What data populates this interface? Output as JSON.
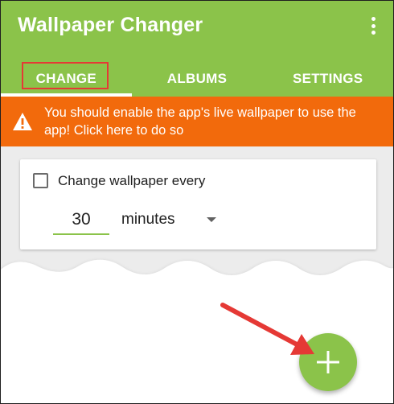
{
  "app": {
    "title": "Wallpaper Changer"
  },
  "tabs": [
    {
      "label": "CHANGE",
      "active": true
    },
    {
      "label": "ALBUMS",
      "active": false
    },
    {
      "label": "SETTINGS",
      "active": false
    }
  ],
  "banner": {
    "line1": "You should enable the app's live wallpaper to use the",
    "line2": "app! Click here to do so",
    "icon": "warning-icon"
  },
  "card": {
    "checkbox_label": "Change wallpaper every",
    "checked": false,
    "interval_value": "30",
    "unit_value": "minutes"
  },
  "fab": {
    "icon": "plus-icon"
  },
  "colors": {
    "primary": "#8bc34a",
    "warning": "#f26a0c",
    "annotation": "#e53935"
  }
}
